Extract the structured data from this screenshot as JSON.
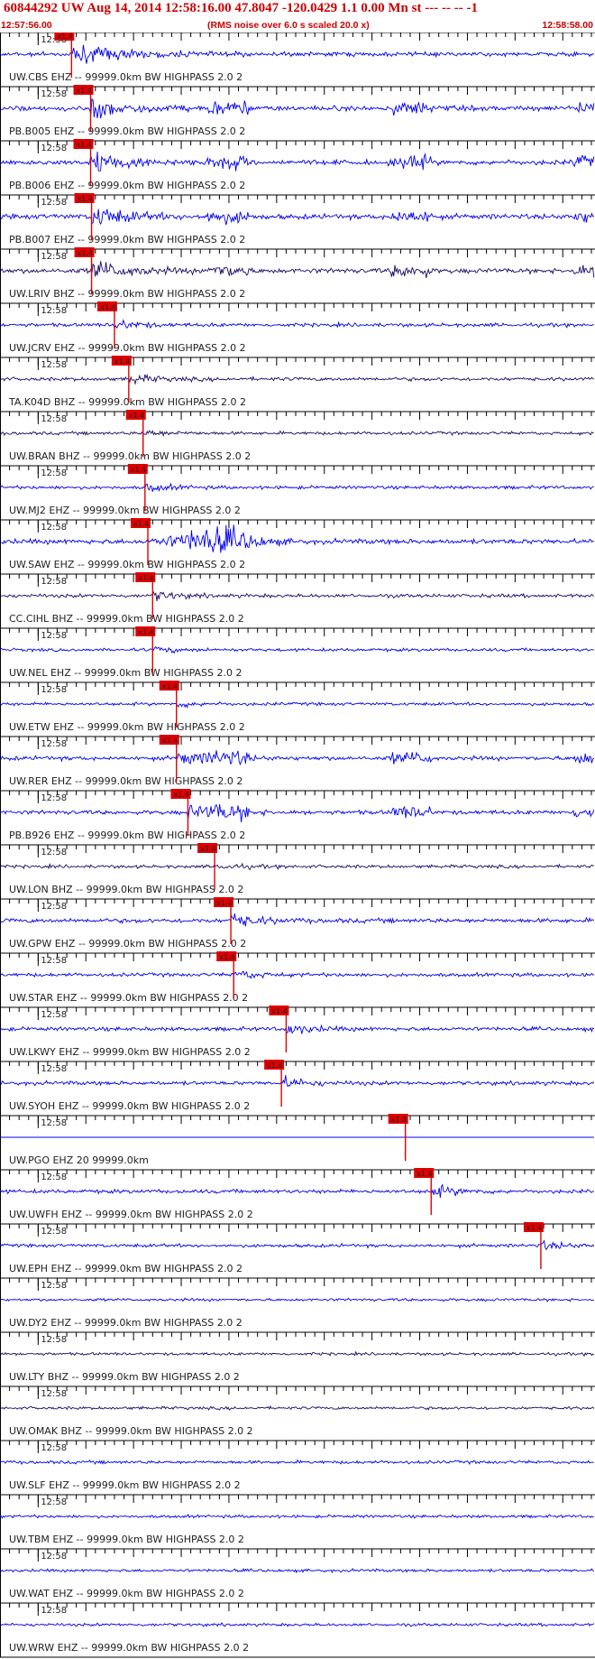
{
  "header": {
    "title": "60844292 UW Aug 14, 2014 12:58:16.00    47.8047 -120.0429  1.1 0.00 Mn st --- -- --   -1",
    "start_time": "12:57:56.00",
    "scaling_note": "(RMS noise over 6.0 s scaled 20.0 x)",
    "end_time": "12:58:58.00"
  },
  "chart_data": {
    "type": "seismogram",
    "minute_marker": "12:58",
    "pick_label": "x1.4",
    "time_range_s": [
      0,
      62
    ],
    "colors": {
      "trace": "#0000ee",
      "trace_dark": "#1a0a66",
      "pick": "#dd0000",
      "grid": "#000000"
    },
    "traces": [
      {
        "label": "UW.CBS EHZ -- 99999.0km BW  HIGHPASS  2.0  2",
        "pick_s": 7.5,
        "color": "blue",
        "amp": 0.7,
        "style": "large"
      },
      {
        "label": "PB.B005 EHZ -- 99999.0km BW  HIGHPASS  2.0  2",
        "pick_s": 9.5,
        "color": "blue",
        "amp": 1.0,
        "style": "burst"
      },
      {
        "label": "PB.B006 EHZ -- 99999.0km BW  HIGHPASS  2.0  2",
        "pick_s": 9.5,
        "color": "blue",
        "amp": 1.0,
        "style": "burst"
      },
      {
        "label": "PB.B007 EHZ -- 99999.0km BW  HIGHPASS  2.0  2",
        "pick_s": 9.6,
        "color": "blue",
        "amp": 1.0,
        "style": "burst"
      },
      {
        "label": "UW.LRIV BHZ -- 99999.0km BW  HIGHPASS  2.0  2",
        "pick_s": 9.6,
        "color": "dark",
        "amp": 1.0,
        "style": "burst"
      },
      {
        "label": "UW.JCRV EHZ -- 99999.0km BW  HIGHPASS  2.0  2",
        "pick_s": 12.0,
        "color": "blue",
        "amp": 0.5,
        "style": "quake"
      },
      {
        "label": "TA.K04D BHZ -- 99999.0km BW  HIGHPASS  2.0  2",
        "pick_s": 13.5,
        "color": "dark",
        "amp": 0.5,
        "style": "quake"
      },
      {
        "label": "UW.BRAN BHZ -- 99999.0km BW  HIGHPASS  2.0  2",
        "pick_s": 15.0,
        "color": "dark",
        "amp": 0.35,
        "style": "noise"
      },
      {
        "label": "UW.MJ2 EHZ -- 99999.0km BW  HIGHPASS  2.0  2",
        "pick_s": 15.2,
        "color": "blue",
        "amp": 0.4,
        "style": "quake"
      },
      {
        "label": "UW.SAW EHZ -- 99999.0km BW  HIGHPASS  2.0  2",
        "pick_s": 15.5,
        "color": "blue",
        "amp": 1.0,
        "style": "big"
      },
      {
        "label": "CC.CIHL BHZ -- 99999.0km BW  HIGHPASS  2.0  2",
        "pick_s": 16.0,
        "color": "dark",
        "amp": 0.5,
        "style": "quake"
      },
      {
        "label": "UW.NEL EHZ -- 99999.0km BW  HIGHPASS  2.0  2",
        "pick_s": 16.0,
        "color": "blue",
        "amp": 0.3,
        "style": "noise"
      },
      {
        "label": "UW.ETW EHZ -- 99999.0km BW  HIGHPASS  2.0  2",
        "pick_s": 18.5,
        "color": "blue",
        "amp": 0.3,
        "style": "noise"
      },
      {
        "label": "UW.RER EHZ -- 99999.0km BW  HIGHPASS  2.0  2",
        "pick_s": 18.5,
        "color": "blue",
        "amp": 0.7,
        "style": "burst"
      },
      {
        "label": "PB.B926 EHZ -- 99999.0km BW  HIGHPASS  2.0  2",
        "pick_s": 19.7,
        "color": "blue",
        "amp": 0.7,
        "style": "burst"
      },
      {
        "label": "UW.LON BHZ -- 99999.0km BW  HIGHPASS  2.0  2",
        "pick_s": 22.5,
        "color": "dark",
        "amp": 0.35,
        "style": "quake"
      },
      {
        "label": "UW.GPW EHZ -- 99999.0km BW  HIGHPASS  2.0  2",
        "pick_s": 24.2,
        "color": "blue",
        "amp": 0.8,
        "style": "quake"
      },
      {
        "label": "UW.STAR EHZ -- 99999.0km BW  HIGHPASS  2.0  2",
        "pick_s": 24.5,
        "color": "blue",
        "amp": 0.5,
        "style": "quake"
      },
      {
        "label": "UW.LKWY EHZ -- 99999.0km BW  HIGHPASS  2.0  2",
        "pick_s": 30.0,
        "color": "blue",
        "amp": 0.6,
        "style": "quake"
      },
      {
        "label": "UW.SYOH EHZ -- 99999.0km BW  HIGHPASS  2.0  2",
        "pick_s": 29.5,
        "color": "blue",
        "amp": 0.6,
        "style": "quake"
      },
      {
        "label": "UW.PGO EHZ 20 99999.0km",
        "pick_s": 42.5,
        "color": "blue",
        "amp": 0.0,
        "style": "flat"
      },
      {
        "label": "UW.UWFH EHZ -- 99999.0km BW  HIGHPASS  2.0  2",
        "pick_s": 45.2,
        "color": "blue",
        "amp": 0.6,
        "style": "quake"
      },
      {
        "label": "UW.EPH EHZ -- 99999.0km BW  HIGHPASS  2.0  2",
        "pick_s": 56.7,
        "color": "blue",
        "amp": 0.4,
        "style": "noise"
      },
      {
        "label": "UW.DY2 EHZ -- 99999.0km BW  HIGHPASS  2.0  2",
        "pick_s": null,
        "color": "blue",
        "amp": 0.2,
        "style": "noise"
      },
      {
        "label": "UW.LTY BHZ -- 99999.0km BW  HIGHPASS  2.0  2",
        "pick_s": null,
        "color": "dark",
        "amp": 0.2,
        "style": "noise"
      },
      {
        "label": "UW.OMAK BHZ -- 99999.0km BW  HIGHPASS  2.0  2",
        "pick_s": null,
        "color": "dark",
        "amp": 0.25,
        "style": "noise"
      },
      {
        "label": "UW.SLF EHZ -- 99999.0km BW  HIGHPASS  2.0  2",
        "pick_s": null,
        "color": "blue",
        "amp": 0.35,
        "style": "noise"
      },
      {
        "label": "UW.TBM EHZ -- 99999.0km BW  HIGHPASS  2.0  2",
        "pick_s": null,
        "color": "blue",
        "amp": 0.25,
        "style": "noise"
      },
      {
        "label": "UW.WAT EHZ -- 99999.0km BW  HIGHPASS  2.0  2",
        "pick_s": null,
        "color": "blue",
        "amp": 0.25,
        "style": "noise"
      },
      {
        "label": "UW.WRW EHZ -- 99999.0km BW  HIGHPASS  2.0  2",
        "pick_s": null,
        "color": "blue",
        "amp": 0.25,
        "style": "noise"
      }
    ]
  }
}
